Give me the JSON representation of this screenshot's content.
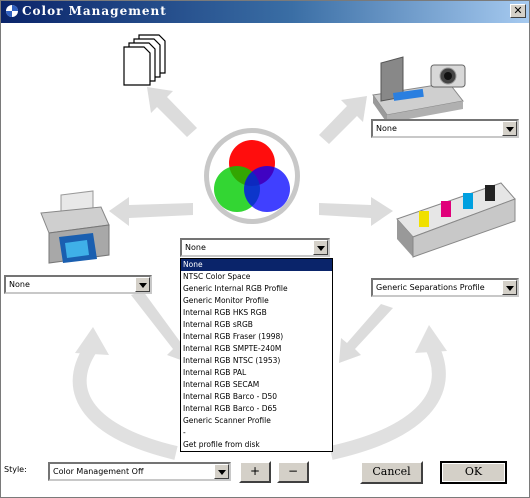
{
  "window": {
    "title": "Color Management",
    "close_glyph": "✕"
  },
  "icons": {
    "title": "color-wheel-icon",
    "document": "documents-icon",
    "scanner": "scanner-camera-icon",
    "printer": "printer-icon",
    "press": "press-icon",
    "rgb": "rgb-circles-icon"
  },
  "selectors": {
    "input": "None",
    "output": "None",
    "center": "None",
    "separations": "Generic Separations Profile"
  },
  "dropdown": {
    "options": [
      "None",
      "NTSC Color Space",
      "Generic Internal RGB Profile",
      "Generic Monitor Profile",
      "Internal RGB HKS RGB",
      "Internal RGB sRGB",
      "Internal RGB Fraser (1998)",
      "Internal RGB SMPTE-240M",
      "Internal RGB NTSC (1953)",
      "Internal RGB PAL",
      "Internal RGB SECAM",
      "Internal RGB Barco - D50",
      "Internal RGB Barco - D65",
      "Generic Scanner Profile",
      "-",
      "Get profile from disk"
    ],
    "highlighted": 0
  },
  "footer": {
    "style_label": "Style:",
    "style_value": "Color Management Off",
    "plus_label": "+",
    "minus_label": "−",
    "cancel_label": "Cancel",
    "ok_label": "OK"
  },
  "colors": {
    "title_start": "#0a246a",
    "title_end": "#a6caf0",
    "highlight": "#0a246a",
    "arrow": "#d8d8d8",
    "red": "#ff0000",
    "green": "#00cc00",
    "blue": "#0000ff"
  }
}
